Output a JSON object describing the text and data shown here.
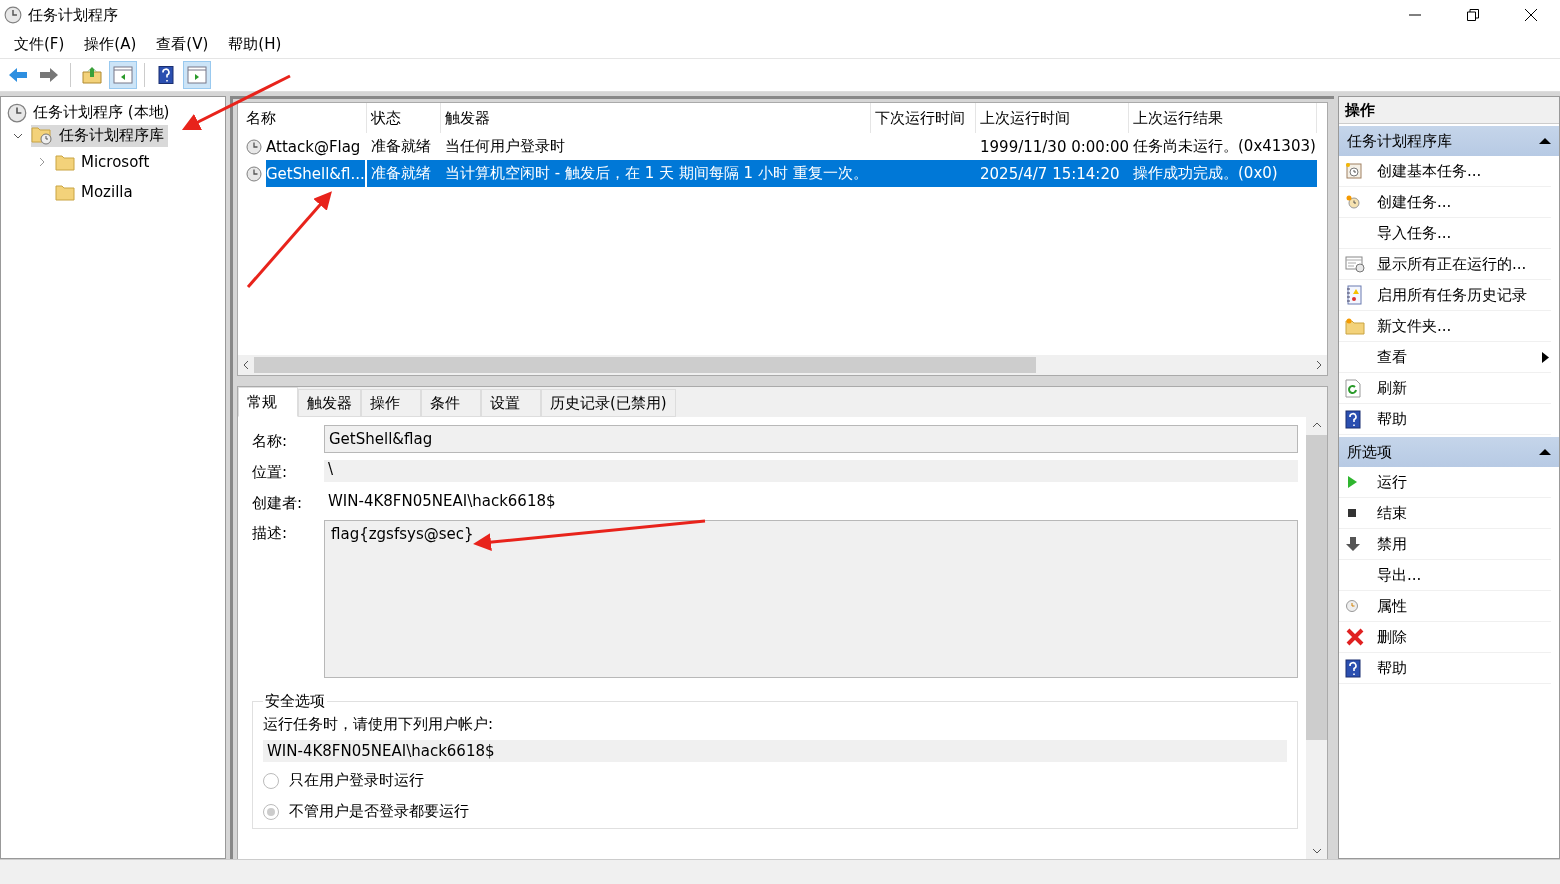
{
  "window": {
    "title": "任务计划程序"
  },
  "menu": [
    "文件(F)",
    "操作(A)",
    "查看(V)",
    "帮助(H)"
  ],
  "toolbar": [
    {
      "kind": "back",
      "selected": false
    },
    {
      "kind": "forward",
      "selected": false
    },
    {
      "kind": "up",
      "selected": false
    },
    {
      "kind": "tree-pane",
      "selected": true
    },
    {
      "kind": "help",
      "selected": false
    },
    {
      "kind": "action-pane",
      "selected": true
    }
  ],
  "tree": {
    "label": "任务计划程序 (本地)",
    "selected": false,
    "children": [
      {
        "label": "任务计划程序库",
        "selected": true,
        "expanded": true,
        "children": [
          {
            "label": "Microsoft",
            "selected": false,
            "expanded": false
          },
          {
            "label": "Mozilla",
            "selected": false
          }
        ]
      }
    ]
  },
  "task_table": {
    "columns": [
      "名称",
      "状态",
      "触发器",
      "下次运行时间",
      "上次运行时间",
      "上次运行结果"
    ],
    "rows": [
      {
        "name": "Attack@Flag",
        "status": "准备就绪",
        "trigger": "当任何用户登录时",
        "last_run": "1999/11/30 0:00:00",
        "last_result": "任务尚未运行。(0x41303)",
        "selected": false
      },
      {
        "name": "GetShell&fl...",
        "status": "准备就绪",
        "trigger": "当计算机空闲时 - 触发后，在 1 天 期间每隔 1 小时 重复一次。",
        "last_run": "2025/4/7 15:14:20",
        "last_result": "操作成功完成。(0x0)",
        "selected": true
      }
    ]
  },
  "detail_tabs": [
    {
      "label": "常规",
      "selected": true
    },
    {
      "label": "触发器",
      "selected": false
    },
    {
      "label": "操作",
      "selected": false
    },
    {
      "label": "条件",
      "selected": false
    },
    {
      "label": "设置",
      "selected": false
    },
    {
      "label": "历史记录(已禁用)",
      "selected": false
    }
  ],
  "general": {
    "name_label": "名称:",
    "name": "GetShell&flag",
    "location_label": "位置:",
    "location": "\\",
    "author_label": "创建者:",
    "author": "WIN-4K8FN05NEAI\\hack6618$",
    "description_label": "描述:",
    "description": "flag{zgsfsys@sec}"
  },
  "security": {
    "title": "安全选项",
    "run_as_label": "运行任务时，请使用下列用户帐户:",
    "account": "WIN-4K8FN05NEAI\\hack6618$",
    "options": [
      {
        "label": "只在用户登录时运行",
        "selected": false
      },
      {
        "label": "不管用户是否登录都要运行",
        "selected": true
      }
    ]
  },
  "actions": {
    "title": "操作",
    "sections": [
      {
        "title": "任务计划程序库",
        "expanded": true,
        "items": [
          {
            "kind": "create-basic",
            "label": "创建基本任务..."
          },
          {
            "kind": "create",
            "label": "创建任务..."
          },
          {
            "kind": "none",
            "label": "导入任务..."
          },
          {
            "kind": "running",
            "label": "显示所有正在运行的..."
          },
          {
            "kind": "history",
            "label": "启用所有任务历史记录"
          },
          {
            "kind": "folder",
            "label": "新文件夹..."
          },
          {
            "kind": "none",
            "label": "查看",
            "submenu": true
          },
          {
            "kind": "refresh",
            "label": "刷新"
          },
          {
            "kind": "help",
            "label": "帮助"
          }
        ]
      },
      {
        "title": "所选项",
        "expanded": true,
        "items": [
          {
            "kind": "run",
            "label": "运行"
          },
          {
            "kind": "end",
            "label": "结束"
          },
          {
            "kind": "disable",
            "label": "禁用"
          },
          {
            "kind": "none",
            "label": "导出..."
          },
          {
            "kind": "properties",
            "label": "属性"
          },
          {
            "kind": "delete",
            "label": "删除"
          },
          {
            "kind": "help",
            "label": "帮助"
          }
        ]
      }
    ]
  }
}
